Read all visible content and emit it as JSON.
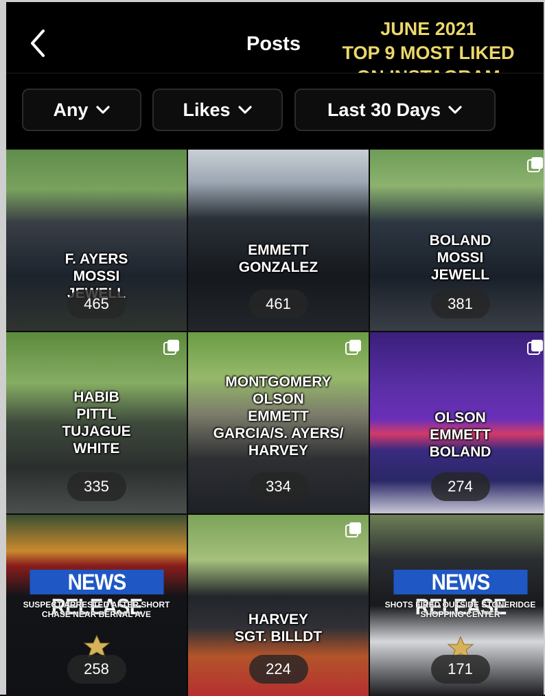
{
  "header": {
    "title": "Posts",
    "promo_lines": [
      "JUNE 2021",
      "TOP 9 MOST LIKED",
      "ON INSTAGRAM"
    ]
  },
  "filters": [
    {
      "label": "Any"
    },
    {
      "label": "Likes"
    },
    {
      "label": "Last 30 Days"
    }
  ],
  "posts": [
    {
      "names": [
        "F. AYERS",
        "MOSSI",
        "JEWELL"
      ],
      "likes": "465",
      "multiple": false
    },
    {
      "names": [
        "EMMETT",
        "GONZALEZ"
      ],
      "likes": "461",
      "multiple": false
    },
    {
      "names": [
        "BOLAND",
        "MOSSI",
        "JEWELL"
      ],
      "likes": "381",
      "multiple": true
    },
    {
      "names": [
        "HABIB",
        "PITTL",
        "TUJAGUE",
        "WHITE"
      ],
      "likes": "335",
      "multiple": true
    },
    {
      "names": [
        "MONTGOMERY",
        "OLSON",
        "EMMETT",
        "GARCIA/S. AYERS/",
        "HARVEY"
      ],
      "likes": "334",
      "multiple": true
    },
    {
      "names": [
        "OLSON",
        "EMMETT",
        "BOLAND"
      ],
      "likes": "274",
      "multiple": true
    },
    {
      "news_title": "NEWS RELEASE",
      "news_lines": [
        "SUSPECT ARRESTED AFTER SHORT",
        "CHASE NEAR BERNAL AVE"
      ],
      "likes": "258",
      "multiple": false
    },
    {
      "names": [
        "HARVEY",
        "SGT. BILLDT"
      ],
      "likes": "224",
      "multiple": true
    },
    {
      "news_title": "NEWS RELEASE",
      "news_lines": [
        "SHOTS FIRED OUTSIDE STONERIDGE",
        "SHOPPING CENTER"
      ],
      "likes": "171",
      "multiple": false
    }
  ],
  "icons": {
    "back": "chevron-left-icon",
    "dropdown": "chevron-down-icon",
    "multiple": "multiple-photos-icon",
    "badge": "police-star-badge-icon"
  },
  "colors": {
    "promo": "#ecd86a",
    "news_banner": "#1f57c4"
  }
}
